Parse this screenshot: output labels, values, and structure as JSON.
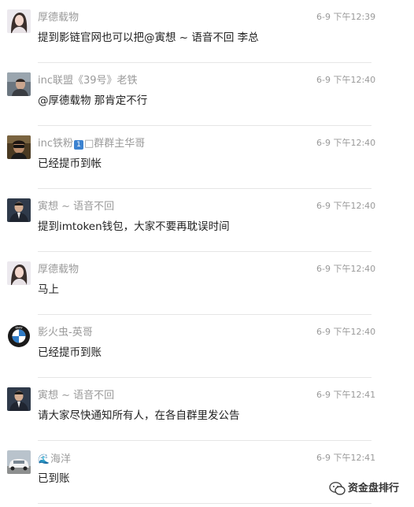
{
  "messages": [
    {
      "sender": "厚德载物",
      "time": "6-9 下午12:39",
      "text": "提到影链官网也可以把@寅想 ~ 语音不回  李总"
    },
    {
      "sender": "inc联盟《39号》老铁",
      "time": "6-9 下午12:40",
      "text": "@厚德载物 那肯定不行"
    },
    {
      "sender_prefix": "inc铁粉",
      "badge": "1",
      "sender_suffix": "□群群主华哥",
      "time": "6-9 下午12:40",
      "text": "已经提币到帐"
    },
    {
      "sender": "寅想 ~ 语音不回",
      "time": "6-9 下午12:40",
      "text": "提到imtoken钱包，大家不要再耽误时间"
    },
    {
      "sender": "厚德载物",
      "time": "6-9 下午12:40",
      "text": "马上"
    },
    {
      "sender": "影火虫-英哥",
      "time": "6-9 下午12:40",
      "text": "已经提币到账"
    },
    {
      "sender": "寅想 ~ 语音不回",
      "time": "6-9 下午12:41",
      "text": "请大家尽快通知所有人，在各自群里发公告"
    },
    {
      "sender_emoji": "🌊",
      "sender": "海洋",
      "time": "6-9 下午12:41",
      "text": "已到账"
    }
  ],
  "avatars": [
    {
      "icon": "woman-portrait-avatar"
    },
    {
      "icon": "man-in-car-avatar"
    },
    {
      "icon": "man-sunglasses-avatar"
    },
    {
      "icon": "man-suit-avatar"
    },
    {
      "icon": "woman-portrait-avatar"
    },
    {
      "icon": "bmw-logo-avatar",
      "logo_text": "BMW"
    },
    {
      "icon": "man-suit-avatar"
    },
    {
      "icon": "white-car-avatar"
    }
  ],
  "watermark": {
    "text": "资金盘排行",
    "icon": "wechat-channel-icon"
  },
  "colors": {
    "meta_text": "#9a9a9a",
    "message_text": "#222222",
    "divider": "#e6e6e6",
    "badge": "#3c82d0"
  }
}
